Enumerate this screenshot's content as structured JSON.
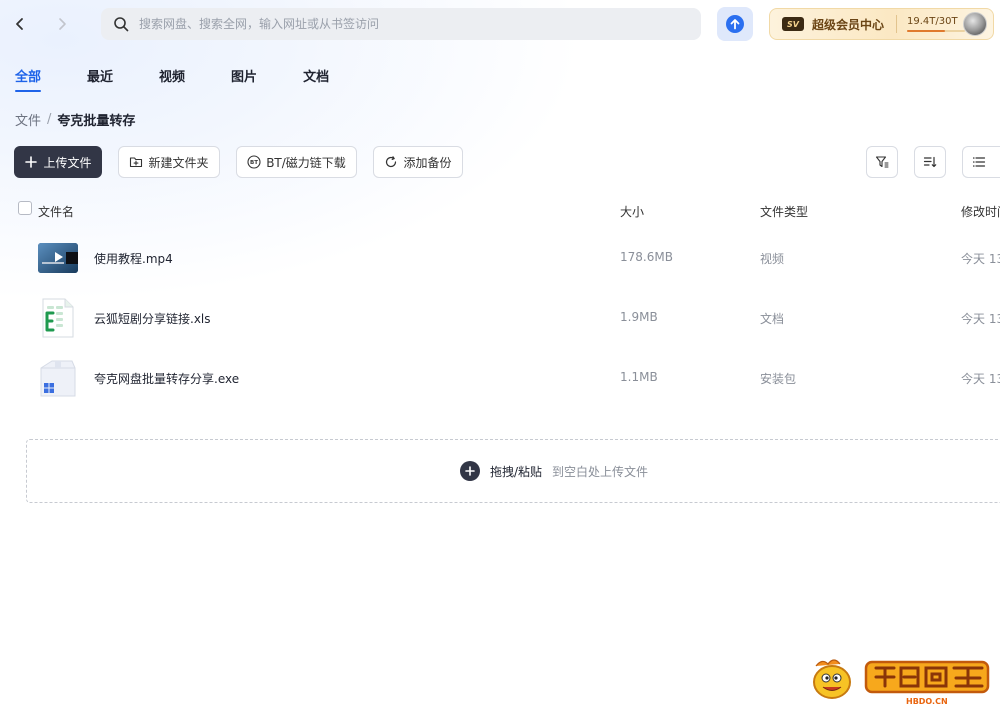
{
  "topbar": {
    "search_placeholder": "搜索网盘、搜索全网，输入网址或从书签访问",
    "vip_label": "超级会员中心",
    "vip_badge": "SV",
    "storage_text": "19.4T/30T",
    "storage_used_fraction": 0.65
  },
  "tabs": [
    {
      "label": "全部",
      "active": true
    },
    {
      "label": "最近",
      "active": false
    },
    {
      "label": "视频",
      "active": false
    },
    {
      "label": "图片",
      "active": false
    },
    {
      "label": "文档",
      "active": false
    }
  ],
  "breadcrumb": {
    "root": "文件",
    "separator": "/",
    "current": "夸克批量转存"
  },
  "toolbar": {
    "upload_label": "上传文件",
    "new_folder_label": "新建文件夹",
    "bt_label": "BT/磁力链下载",
    "backup_label": "添加备份"
  },
  "table": {
    "headers": {
      "name": "文件名",
      "size": "大小",
      "type": "文件类型",
      "modified": "修改时间"
    },
    "rows": [
      {
        "name": "使用教程.mp4",
        "size": "178.6MB",
        "type": "视频",
        "modified": "今天 13",
        "icon": "video-file-icon"
      },
      {
        "name": "云狐短剧分享链接.xls",
        "size": "1.9MB",
        "type": "文档",
        "modified": "今天 13",
        "icon": "excel-file-icon"
      },
      {
        "name": "夸克网盘批量转存分享.exe",
        "size": "1.1MB",
        "type": "安装包",
        "modified": "今天 13",
        "icon": "exe-file-icon"
      }
    ]
  },
  "dropzone": {
    "main": "拖拽/粘贴",
    "sub": "到空白处上传文件"
  },
  "watermark": {
    "site": "HBDO.CN"
  },
  "colors": {
    "accent": "#1e63e9",
    "dark_button": "#323646",
    "vip_gold": "#fbe8c3"
  }
}
